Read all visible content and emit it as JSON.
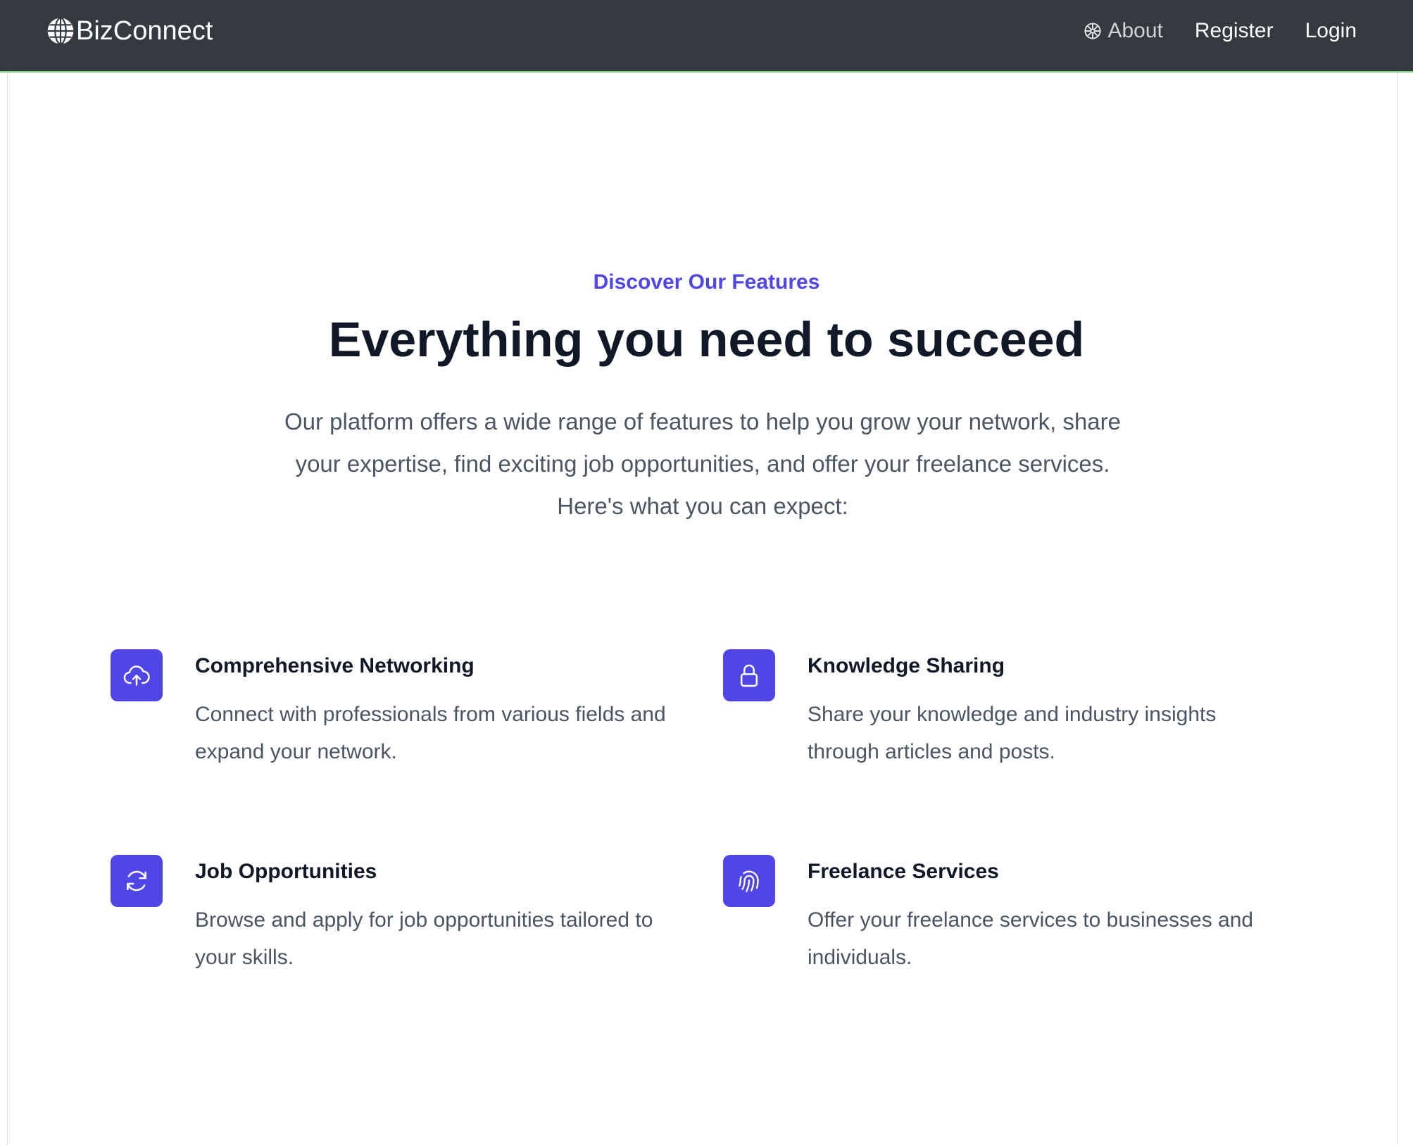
{
  "nav": {
    "brand": "BizConnect",
    "brand_icon": "globe-icon",
    "about_icon": "dharma-wheel-icon",
    "links": {
      "about": "About",
      "register": "Register",
      "login": "Login"
    }
  },
  "hero": {
    "eyebrow": "Discover Our Features",
    "title": "Everything you need to succeed",
    "intro": "Our platform offers a wide range of features to help you grow your network, share your expertise, find exciting job opportunities, and offer your freelance services. Here's what you can expect:"
  },
  "features": [
    {
      "icon": "cloud-upload-icon",
      "title": "Comprehensive Networking",
      "description": "Connect with professionals from various fields and expand your network."
    },
    {
      "icon": "lock-icon",
      "title": "Knowledge Sharing",
      "description": "Share your knowledge and industry insights through articles and posts."
    },
    {
      "icon": "refresh-icon",
      "title": "Job Opportunities",
      "description": "Browse and apply for job opportunities tailored to your skills."
    },
    {
      "icon": "fingerprint-icon",
      "title": "Freelance Services",
      "description": "Offer your freelance services to businesses and individuals."
    }
  ],
  "colors": {
    "navbar": "#343a40",
    "accent": "#4f46e5",
    "heading": "#111827",
    "body_text": "#4b5563"
  }
}
